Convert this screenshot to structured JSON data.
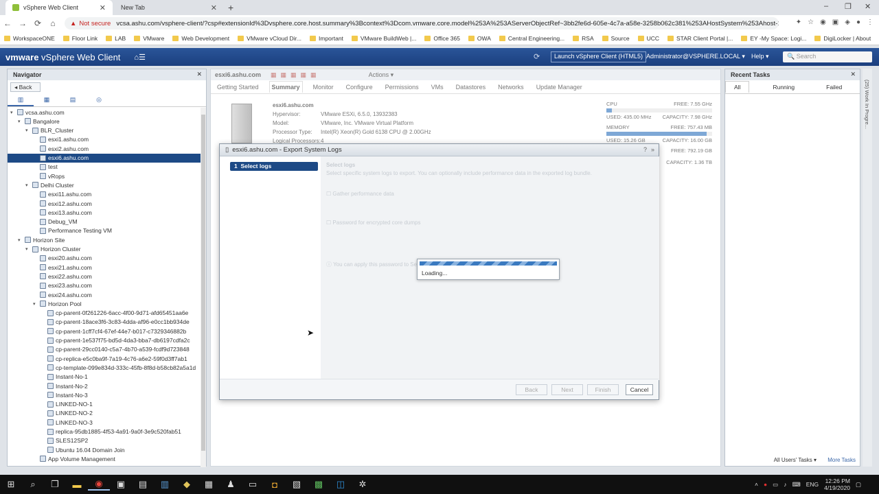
{
  "browser": {
    "tabs": [
      {
        "label": "vSphere Web Client",
        "active": true
      },
      {
        "label": "New Tab",
        "active": false
      }
    ],
    "new_tab_glyph": "+",
    "window_controls": [
      "–",
      "❐",
      "✕"
    ],
    "not_secure": "Not secure",
    "url": "vcsa.ashu.com/vsphere-client/?csp#extensionId%3Dvsphere.core.host.summary%3Bcontext%3Dcom.vmware.core.model%253A%253AServerObjectRef~3bb2fe6d-605e-4c7a-a58e-3258b062c381%253AHostSystem%253Ahost-132~c...",
    "bookmarks": [
      "WorkspaceONE",
      "Floor Link",
      "LAB",
      "VMware",
      "Web Development",
      "VMware vCloud Dir...",
      "Important",
      "VMware BuildWeb |...",
      "Office 365",
      "OWA",
      "Central Engineering...",
      "RSA",
      "Source",
      "UCC",
      "STAR Client Portal |...",
      "EY -My Space: Logi...",
      "DigiLocker | About"
    ]
  },
  "vheader": {
    "brand_prefix": "vmware",
    "brand_name": "vSphere Web Client",
    "launch_button": "Launch vSphere Client (HTML5)",
    "user": "Administrator@VSPHERE.LOCAL ▾",
    "help": "Help ▾",
    "search_placeholder": "Search"
  },
  "navigator": {
    "title": "Navigator",
    "back": "Back",
    "tree": [
      {
        "label": "vcsa.ashu.com",
        "depth": 0,
        "toggle": "▾"
      },
      {
        "label": "Bangalore",
        "depth": 1,
        "toggle": "▾"
      },
      {
        "label": "BLR_Cluster",
        "depth": 2,
        "toggle": "▾"
      },
      {
        "label": "esxi1.ashu.com",
        "depth": 3,
        "toggle": ""
      },
      {
        "label": "esxi2.ashu.com",
        "depth": 3,
        "toggle": ""
      },
      {
        "label": "esxi6.ashu.com",
        "depth": 3,
        "toggle": "",
        "selected": true
      },
      {
        "label": "test",
        "depth": 3,
        "toggle": ""
      },
      {
        "label": "vRops",
        "depth": 3,
        "toggle": ""
      },
      {
        "label": "Delhi Cluster",
        "depth": 2,
        "toggle": "▾"
      },
      {
        "label": "esxi11.ashu.com",
        "depth": 3,
        "toggle": ""
      },
      {
        "label": "esxi12.ashu.com",
        "depth": 3,
        "toggle": ""
      },
      {
        "label": "esxi13.ashu.com",
        "depth": 3,
        "toggle": ""
      },
      {
        "label": "Debug_VM",
        "depth": 3,
        "toggle": ""
      },
      {
        "label": "Performance Testing VM",
        "depth": 3,
        "toggle": ""
      },
      {
        "label": "Horizon Site",
        "depth": 1,
        "toggle": "▾"
      },
      {
        "label": "Horizon Cluster",
        "depth": 2,
        "toggle": "▾"
      },
      {
        "label": "esxi20.ashu.com",
        "depth": 3,
        "toggle": ""
      },
      {
        "label": "esxi21.ashu.com",
        "depth": 3,
        "toggle": ""
      },
      {
        "label": "esxi22.ashu.com",
        "depth": 3,
        "toggle": ""
      },
      {
        "label": "esxi23.ashu.com",
        "depth": 3,
        "toggle": ""
      },
      {
        "label": "esxi24.ashu.com",
        "depth": 3,
        "toggle": ""
      },
      {
        "label": "Horizon Pool",
        "depth": 3,
        "toggle": "▾"
      },
      {
        "label": "cp-parent-0f261226-6acc-4f00-9d71-afd65451aa6e",
        "depth": 4,
        "toggle": ""
      },
      {
        "label": "cp-parent-18ace3f6-3c83-4dda-af96-e0cc1bb934de",
        "depth": 4,
        "toggle": ""
      },
      {
        "label": "cp-parent-1cff7cf4-67ef-44e7-b017-c7329346882b",
        "depth": 4,
        "toggle": ""
      },
      {
        "label": "cp-parent-1e537f75-bd5d-4da3-bba7-db6197cdfa2c",
        "depth": 4,
        "toggle": ""
      },
      {
        "label": "cp-parent-29cc0140-c5a7-4b70-a539-fcdf9d723848",
        "depth": 4,
        "toggle": ""
      },
      {
        "label": "cp-replica-e5c0ba9f-7a19-4c76-a6e2-59f0d3ff7ab1",
        "depth": 4,
        "toggle": ""
      },
      {
        "label": "cp-template-099e834d-333c-45fb-8f8d-b58cb82a5a1d",
        "depth": 4,
        "toggle": ""
      },
      {
        "label": "Instant-No-1",
        "depth": 4,
        "toggle": ""
      },
      {
        "label": "Instant-No-2",
        "depth": 4,
        "toggle": ""
      },
      {
        "label": "Instant-No-3",
        "depth": 4,
        "toggle": ""
      },
      {
        "label": "LINKED-NO-1",
        "depth": 4,
        "toggle": ""
      },
      {
        "label": "LINKED-NO-2",
        "depth": 4,
        "toggle": ""
      },
      {
        "label": "LINKED-NO-3",
        "depth": 4,
        "toggle": ""
      },
      {
        "label": "replica-95db1885-4f53-4a91-9a0f-3e9c520fab51",
        "depth": 4,
        "toggle": ""
      },
      {
        "label": "SLES12SP2",
        "depth": 4,
        "toggle": ""
      },
      {
        "label": "Ubuntu 16.04 Domain Join",
        "depth": 4,
        "toggle": ""
      },
      {
        "label": "App Volume Management",
        "depth": 3,
        "toggle": ""
      }
    ]
  },
  "main": {
    "object_title": "esxi6.ashu.com",
    "actions": "Actions ▾",
    "tabs": [
      {
        "label": "Getting Started",
        "active": false
      },
      {
        "label": "Summary",
        "active": true
      },
      {
        "label": "Monitor",
        "active": false
      },
      {
        "label": "Configure",
        "active": false
      },
      {
        "label": "Permissions",
        "active": false
      },
      {
        "label": "VMs",
        "active": false
      },
      {
        "label": "Datastores",
        "active": false
      },
      {
        "label": "Networks",
        "active": false
      },
      {
        "label": "Update Manager",
        "active": false
      }
    ],
    "host_name": "esxi6.ashu.com",
    "summary": [
      {
        "k": "Hypervisor:",
        "v": "VMware ESXi, 6.5.0, 13932383"
      },
      {
        "k": "Model:",
        "v": "VMware, Inc. VMware Virtual Platform"
      },
      {
        "k": "Processor Type:",
        "v": "Intel(R) Xeon(R) Gold 6138 CPU @ 2.00GHz"
      },
      {
        "k": "Logical Processors:",
        "v": "4"
      }
    ],
    "resources": {
      "cpu": {
        "label": "CPU",
        "free": "FREE: 7.55 GHz",
        "used": "USED: 435.00 MHz",
        "capacity": "CAPACITY: 7.98 GHz",
        "used_fraction": 0.05
      },
      "memory": {
        "label": "MEMORY",
        "free": "FREE: 757.43 MB",
        "used": "USED: 15.26 GB",
        "capacity": "CAPACITY: 16.00 GB",
        "used_fraction": 0.95
      },
      "storage": {
        "free": "FREE: 792.19 GB",
        "capacity": "CAPACITY: 1.36 TB"
      }
    }
  },
  "dialog": {
    "title": "esxi6.ashu.com - Export System Logs",
    "step_number": "1",
    "step_label": "Select logs",
    "faint_header": "Select logs",
    "faint_desc": "Select specific system logs to export. You can optionally include performance data in the exported log bundle.",
    "faint_perf": "Gather performance data",
    "faint_password": "Password for encrypted core dumps",
    "faint_note": "You can apply this password to Service Request",
    "loading_text": "Loading...",
    "buttons": {
      "back": "Back",
      "next": "Next",
      "finish": "Finish",
      "cancel": "Cancel"
    }
  },
  "tasks": {
    "title": "Recent Tasks",
    "tabs": [
      "All",
      "Running",
      "Failed"
    ],
    "footer_filter": "All Users' Tasks ▾",
    "footer_more": "More Tasks",
    "side_label": "(25) Work In Progre..."
  },
  "taskbar": {
    "language": "ENG",
    "time": "12:26 PM",
    "date": "4/19/2020"
  }
}
